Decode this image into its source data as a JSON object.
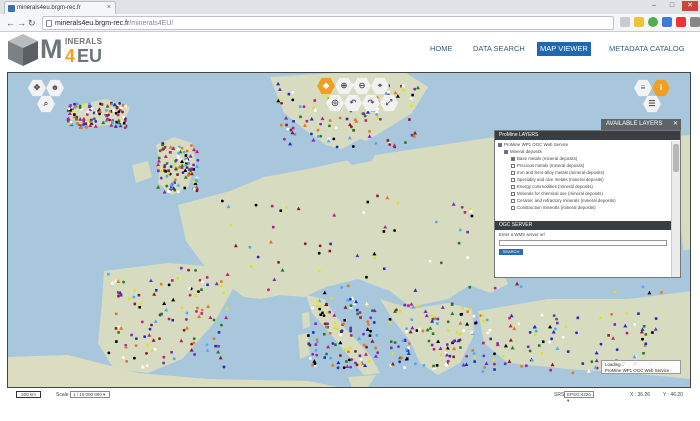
{
  "browser": {
    "tab_title": "minerals4eu.brgm-rec.fr",
    "url_host": "minerals4eu.brgm-rec.fr",
    "url_path": "/minerals4EU/",
    "back_icon": "arrow-left-icon",
    "forward_icon": "arrow-right-icon"
  },
  "logo": {
    "m": "M",
    "inerals": "INERALS",
    "four": "4",
    "eu": "EU"
  },
  "nav": {
    "items": [
      {
        "label": "HOME",
        "active": false
      },
      {
        "label": "DATA SEARCH",
        "active": false
      },
      {
        "label": "MAP VIEWER",
        "active": true
      },
      {
        "label": "METADATA CATALOG",
        "active": false
      }
    ]
  },
  "map_tools": {
    "left": [
      "pan-icon",
      "users-icon",
      "zoom-search-icon"
    ],
    "center": [
      "select-icon",
      "zoom-in-icon",
      "zoom-out-icon",
      "identify-icon",
      "undo-icon",
      "redo-icon",
      "share-icon",
      "fullscreen-icon"
    ],
    "right": [
      "layers-icon",
      "info-icon",
      "legend-icon"
    ]
  },
  "layers_panel": {
    "header": "AVAILABLE LAYERS",
    "close": "✕",
    "title": "ProMine LAYERS",
    "items": [
      {
        "label": "ProMine WP1 OGC Web Service",
        "checked": true,
        "level": 0
      },
      {
        "label": "Mineral deposits",
        "checked": true,
        "level": 1
      },
      {
        "label": "Base metals (mineral deposits)",
        "checked": true,
        "level": 2
      },
      {
        "label": "Precious metals (mineral deposits)",
        "checked": false,
        "level": 2
      },
      {
        "label": "Iron and ferro-alloy metals (mineral deposits)",
        "checked": false,
        "level": 2
      },
      {
        "label": "Speciality and rare metals (mineral deposits)",
        "checked": false,
        "level": 2
      },
      {
        "label": "Energy commodities (mineral deposits)",
        "checked": false,
        "level": 2
      },
      {
        "label": "Minerals for chemical use (mineral deposits)",
        "checked": false,
        "level": 2
      },
      {
        "label": "Ceramic and refractory minerals (mineral deposits)",
        "checked": false,
        "level": 2
      },
      {
        "label": "Construction minerals (mineral deposits)",
        "checked": false,
        "level": 2
      }
    ],
    "ogc_header": "OGC SERVER",
    "ogc_label": "Enter a WMS server url",
    "ogc_input": "",
    "ogc_button": "SEARCH"
  },
  "loading": {
    "line1": "Loading...",
    "line2": "ProMine WP1 OGC Web Service"
  },
  "footer": {
    "scale_bar": "200 km",
    "scale_label": "Scale",
    "scale_value": "1 / 10 000 000",
    "srs_label": "SRS",
    "srs_value": "EPSG:4326",
    "x": "X : 36.26",
    "y": "Y : 46.20"
  },
  "colors": {
    "sea": "#a8c7dd",
    "land": "#d7dcc1",
    "nav_active": "#1f69b1",
    "tool_orange": "#f0a020",
    "panel_header": "#3a3d41"
  }
}
